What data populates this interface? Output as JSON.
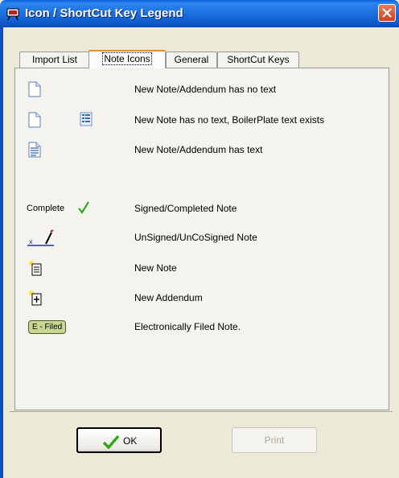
{
  "window": {
    "title": "Icon / ShortCut Key Legend"
  },
  "tabs": [
    {
      "label": "Import List",
      "active": false
    },
    {
      "label": "Note Icons",
      "active": true
    },
    {
      "label": "General",
      "active": false
    },
    {
      "label": "ShortCut Keys",
      "active": false
    }
  ],
  "legend": {
    "rows": [
      {
        "icon": "blank-note-icon",
        "label": "New Note/Addendum has no text"
      },
      {
        "icon": "blank-note-icon",
        "icon2": "boilerplate-icon",
        "label": "New Note has no text, BoilerPlate text exists"
      },
      {
        "icon": "text-note-icon",
        "label": "New Note/Addendum has text"
      },
      {
        "icon_text": "Complete",
        "icon": "green-check-icon",
        "label": "Signed/Completed Note"
      },
      {
        "icon": "unsigned-pen-icon",
        "label": "UnSigned/UnCoSigned Note"
      },
      {
        "icon": "new-note-icon",
        "label": "New Note"
      },
      {
        "icon": "new-addendum-icon",
        "label": "New Addendum"
      },
      {
        "icon_text": "E - Filed",
        "label": "Electronically Filed Note."
      }
    ]
  },
  "buttons": {
    "ok": "OK",
    "print": "Print"
  },
  "colors": {
    "title_bar": "#1b6fe0",
    "tab_highlight": "#e68b2c",
    "check_green": "#2fa81a",
    "efiled_bg": "#c7d690"
  }
}
